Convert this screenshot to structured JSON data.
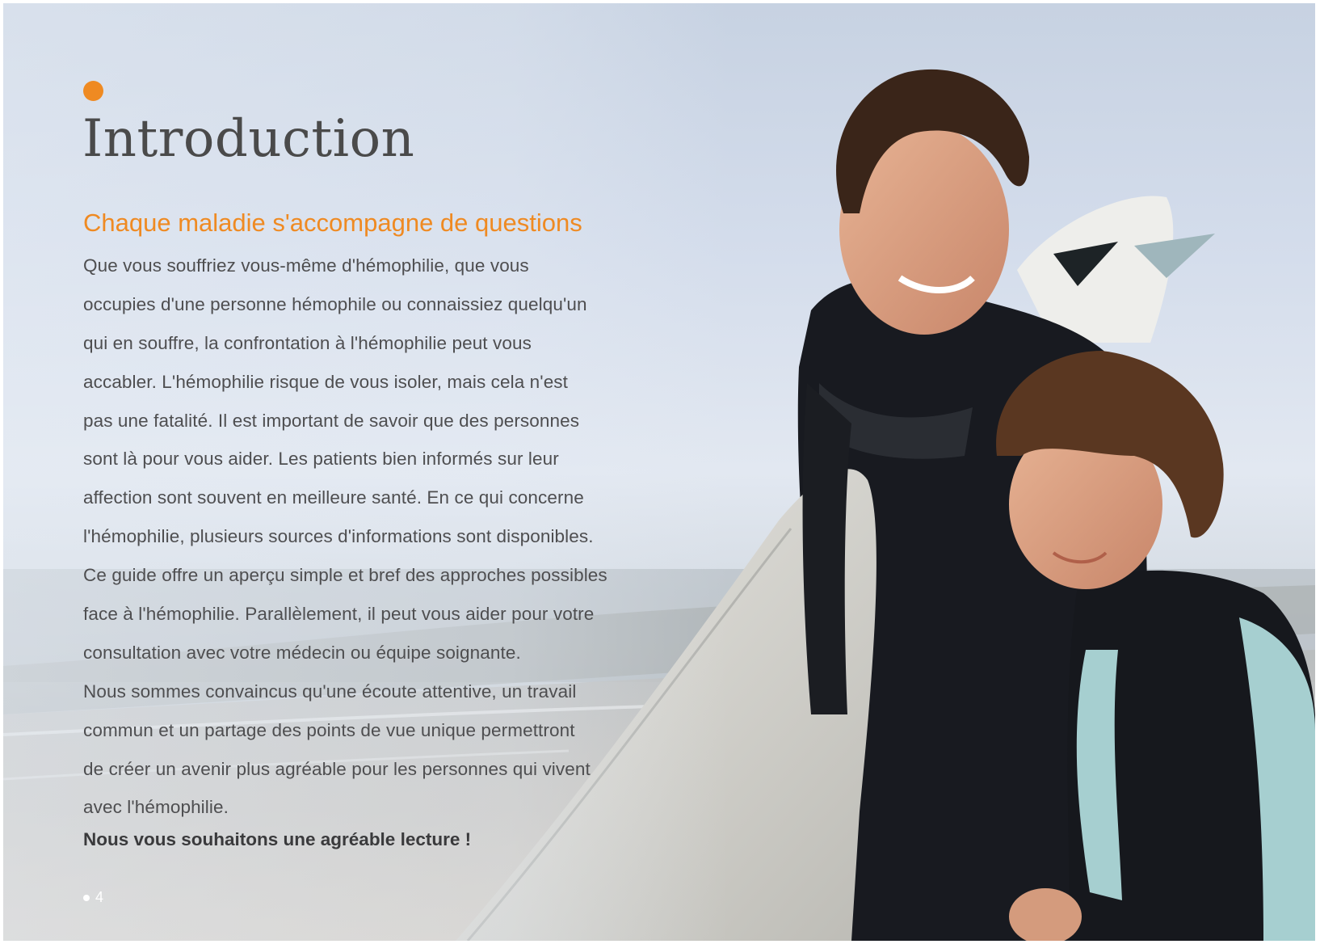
{
  "page": {
    "title": "Introduction",
    "subtitle": "Chaque maladie s'accompagne de questions",
    "paragraph_lines": [
      "Que vous souffriez vous-même d'hémophilie, que vous",
      "occupies d'une personne hémophile ou connaissiez quelqu'un",
      "qui en souffre, la confrontation à l'hémophilie peut vous",
      "accabler. L'hémophilie risque de vous isoler, mais cela n'est",
      "pas une fatalité. Il est important de savoir que des personnes",
      "sont là pour vous aider. Les patients bien informés sur leur",
      "affection sont souvent en meilleure santé. En ce qui concerne",
      "l'hémophilie, plusieurs sources d'informations sont disponibles.",
      "Ce guide offre un aperçu simple et bref des approches possibles",
      "face à l'hémophilie. Parallèlement, il peut vous aider pour votre",
      "consultation avec votre médecin ou équipe soignante.",
      "Nous sommes convaincus qu'une écoute attentive, un travail",
      "commun et un partage des points de vue unique permettront",
      "de créer un avenir plus agréable pour les personnes qui vivent",
      "avec l'hémophilie."
    ],
    "closing": "Nous vous souhaitons une agréable lecture !",
    "page_number": "4"
  },
  "colors": {
    "accent": "#ef8a22",
    "text": "#4e4e50",
    "title": "#4a4a4a"
  },
  "icons": {
    "heading_bullet": "orange-dot-icon",
    "page_bullet": "white-dot-icon"
  }
}
